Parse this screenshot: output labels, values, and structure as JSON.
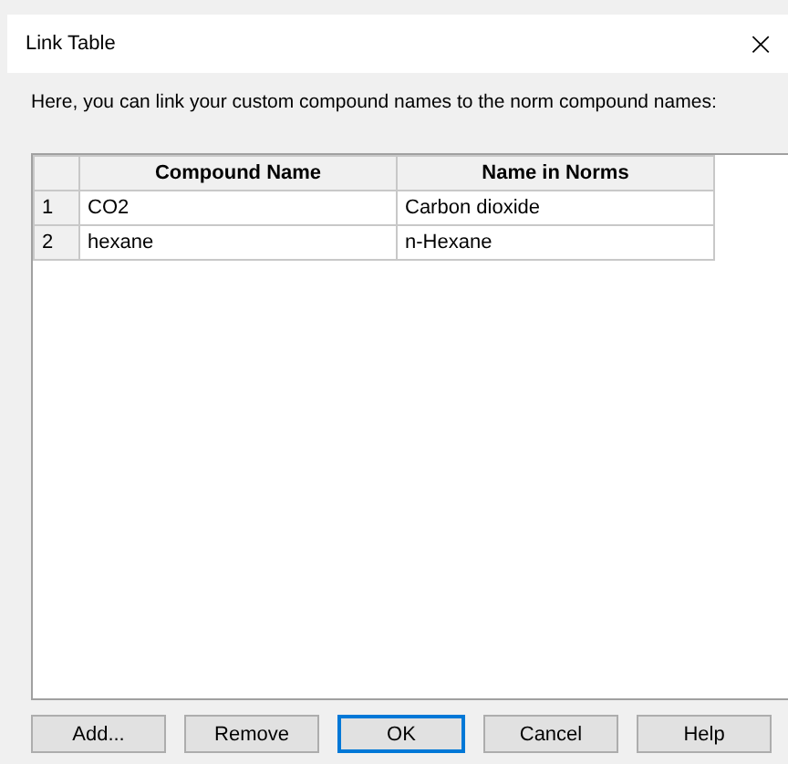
{
  "window": {
    "title": "Link Table",
    "close": "×"
  },
  "instruction": "Here, you can link your custom compound names to the norm compound names:",
  "table": {
    "columns": [
      "Compound Name",
      "Name in Norms"
    ],
    "rows": [
      {
        "index": "1",
        "cells": [
          "CO2",
          "Carbon dioxide"
        ]
      },
      {
        "index": "2",
        "cells": [
          "hexane",
          "n-Hexane"
        ]
      }
    ]
  },
  "buttons": [
    {
      "label": "Add...",
      "default": false
    },
    {
      "label": "Remove",
      "default": false
    },
    {
      "label": "OK",
      "default": true
    },
    {
      "label": "Cancel",
      "default": false
    },
    {
      "label": "Help",
      "default": false
    }
  ]
}
